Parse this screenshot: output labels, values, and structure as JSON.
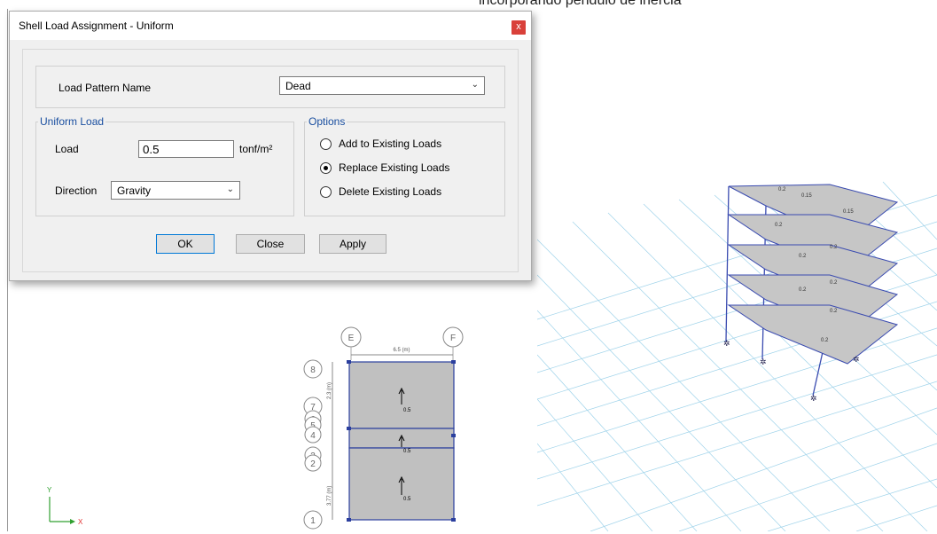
{
  "caption": "incorporando péndulo de inercia",
  "dialog": {
    "title": "Shell Load Assignment - Uniform",
    "close_glyph": "x",
    "load_pattern_label": "Load Pattern Name",
    "load_pattern_value": "Dead",
    "uniform_load": {
      "group_label": "Uniform Load",
      "load_label": "Load",
      "load_value": "0.5",
      "load_unit": "tonf/m²",
      "direction_label": "Direction",
      "direction_value": "Gravity"
    },
    "options": {
      "group_label": "Options",
      "items": [
        {
          "label": "Add to Existing Loads",
          "checked": false
        },
        {
          "label": "Replace Existing Loads",
          "checked": true
        },
        {
          "label": "Delete Existing Loads",
          "checked": false
        }
      ]
    },
    "buttons": {
      "ok": "OK",
      "close": "Close",
      "apply": "Apply"
    }
  },
  "plan_view": {
    "grid_columns": [
      "E",
      "F"
    ],
    "grid_rows": [
      "8",
      "7",
      "6",
      "5",
      "4",
      "3",
      "2",
      "1"
    ],
    "dimension_label": "6.5 (m)",
    "vertical_dims": [
      "2.3 (m)",
      "3.77 (m)"
    ],
    "panel_load_labels": [
      "0.5",
      "0.5",
      "0.5"
    ],
    "axes": {
      "x": "X",
      "y": "Y"
    },
    "colors": {
      "panel": "#c0c0c0",
      "frame": "#2b3f9e",
      "axis_x": "#e03030",
      "axis_y": "#30a030"
    }
  },
  "view_3d": {
    "floor_labels": [
      "0.2",
      "0.15",
      "0.15",
      "0.2",
      "0.2",
      "0.2",
      "0.2",
      "0.2",
      "0.2",
      "0.2"
    ],
    "colors": {
      "grid": "#9fd3ea",
      "slab": "#c6c6c6",
      "frame": "#3a4bb0"
    }
  }
}
